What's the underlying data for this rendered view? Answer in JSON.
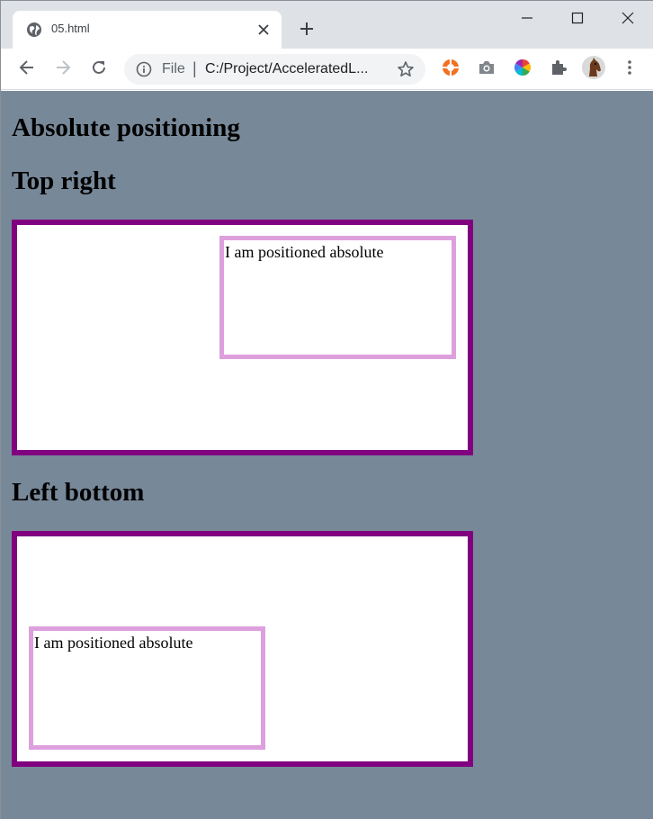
{
  "browser": {
    "tab": {
      "title": "05.html"
    },
    "address_bar": {
      "scheme_label": "File",
      "separator": "|",
      "url": "C:/Project/AcceleratedL..."
    },
    "icons": {
      "favicon": "globe-icon",
      "close_tab": "close-icon",
      "new_tab": "plus-icon",
      "minimize": "minimize-icon",
      "maximize": "maximize-icon",
      "close_window": "close-window-icon",
      "back": "back-arrow-icon",
      "forward": "forward-arrow-icon",
      "reload": "reload-icon",
      "site_info": "info-icon",
      "bookmark": "star-icon",
      "extensions": [
        "lifebuoy-icon",
        "camera-icon",
        "color-wheel-icon",
        "puzzle-icon"
      ],
      "profile": "horse-avatar-icon",
      "menu": "kebab-menu-icon"
    }
  },
  "page": {
    "background_color": "#778899",
    "title": "Absolute positioning",
    "sections": [
      {
        "heading": "Top right",
        "box_text": "I am positioned absolute"
      },
      {
        "heading": "Left bottom",
        "box_text": "I am positioned absolute"
      }
    ],
    "container_border_color": "#800080",
    "box_border_color": "#dda0dd"
  }
}
